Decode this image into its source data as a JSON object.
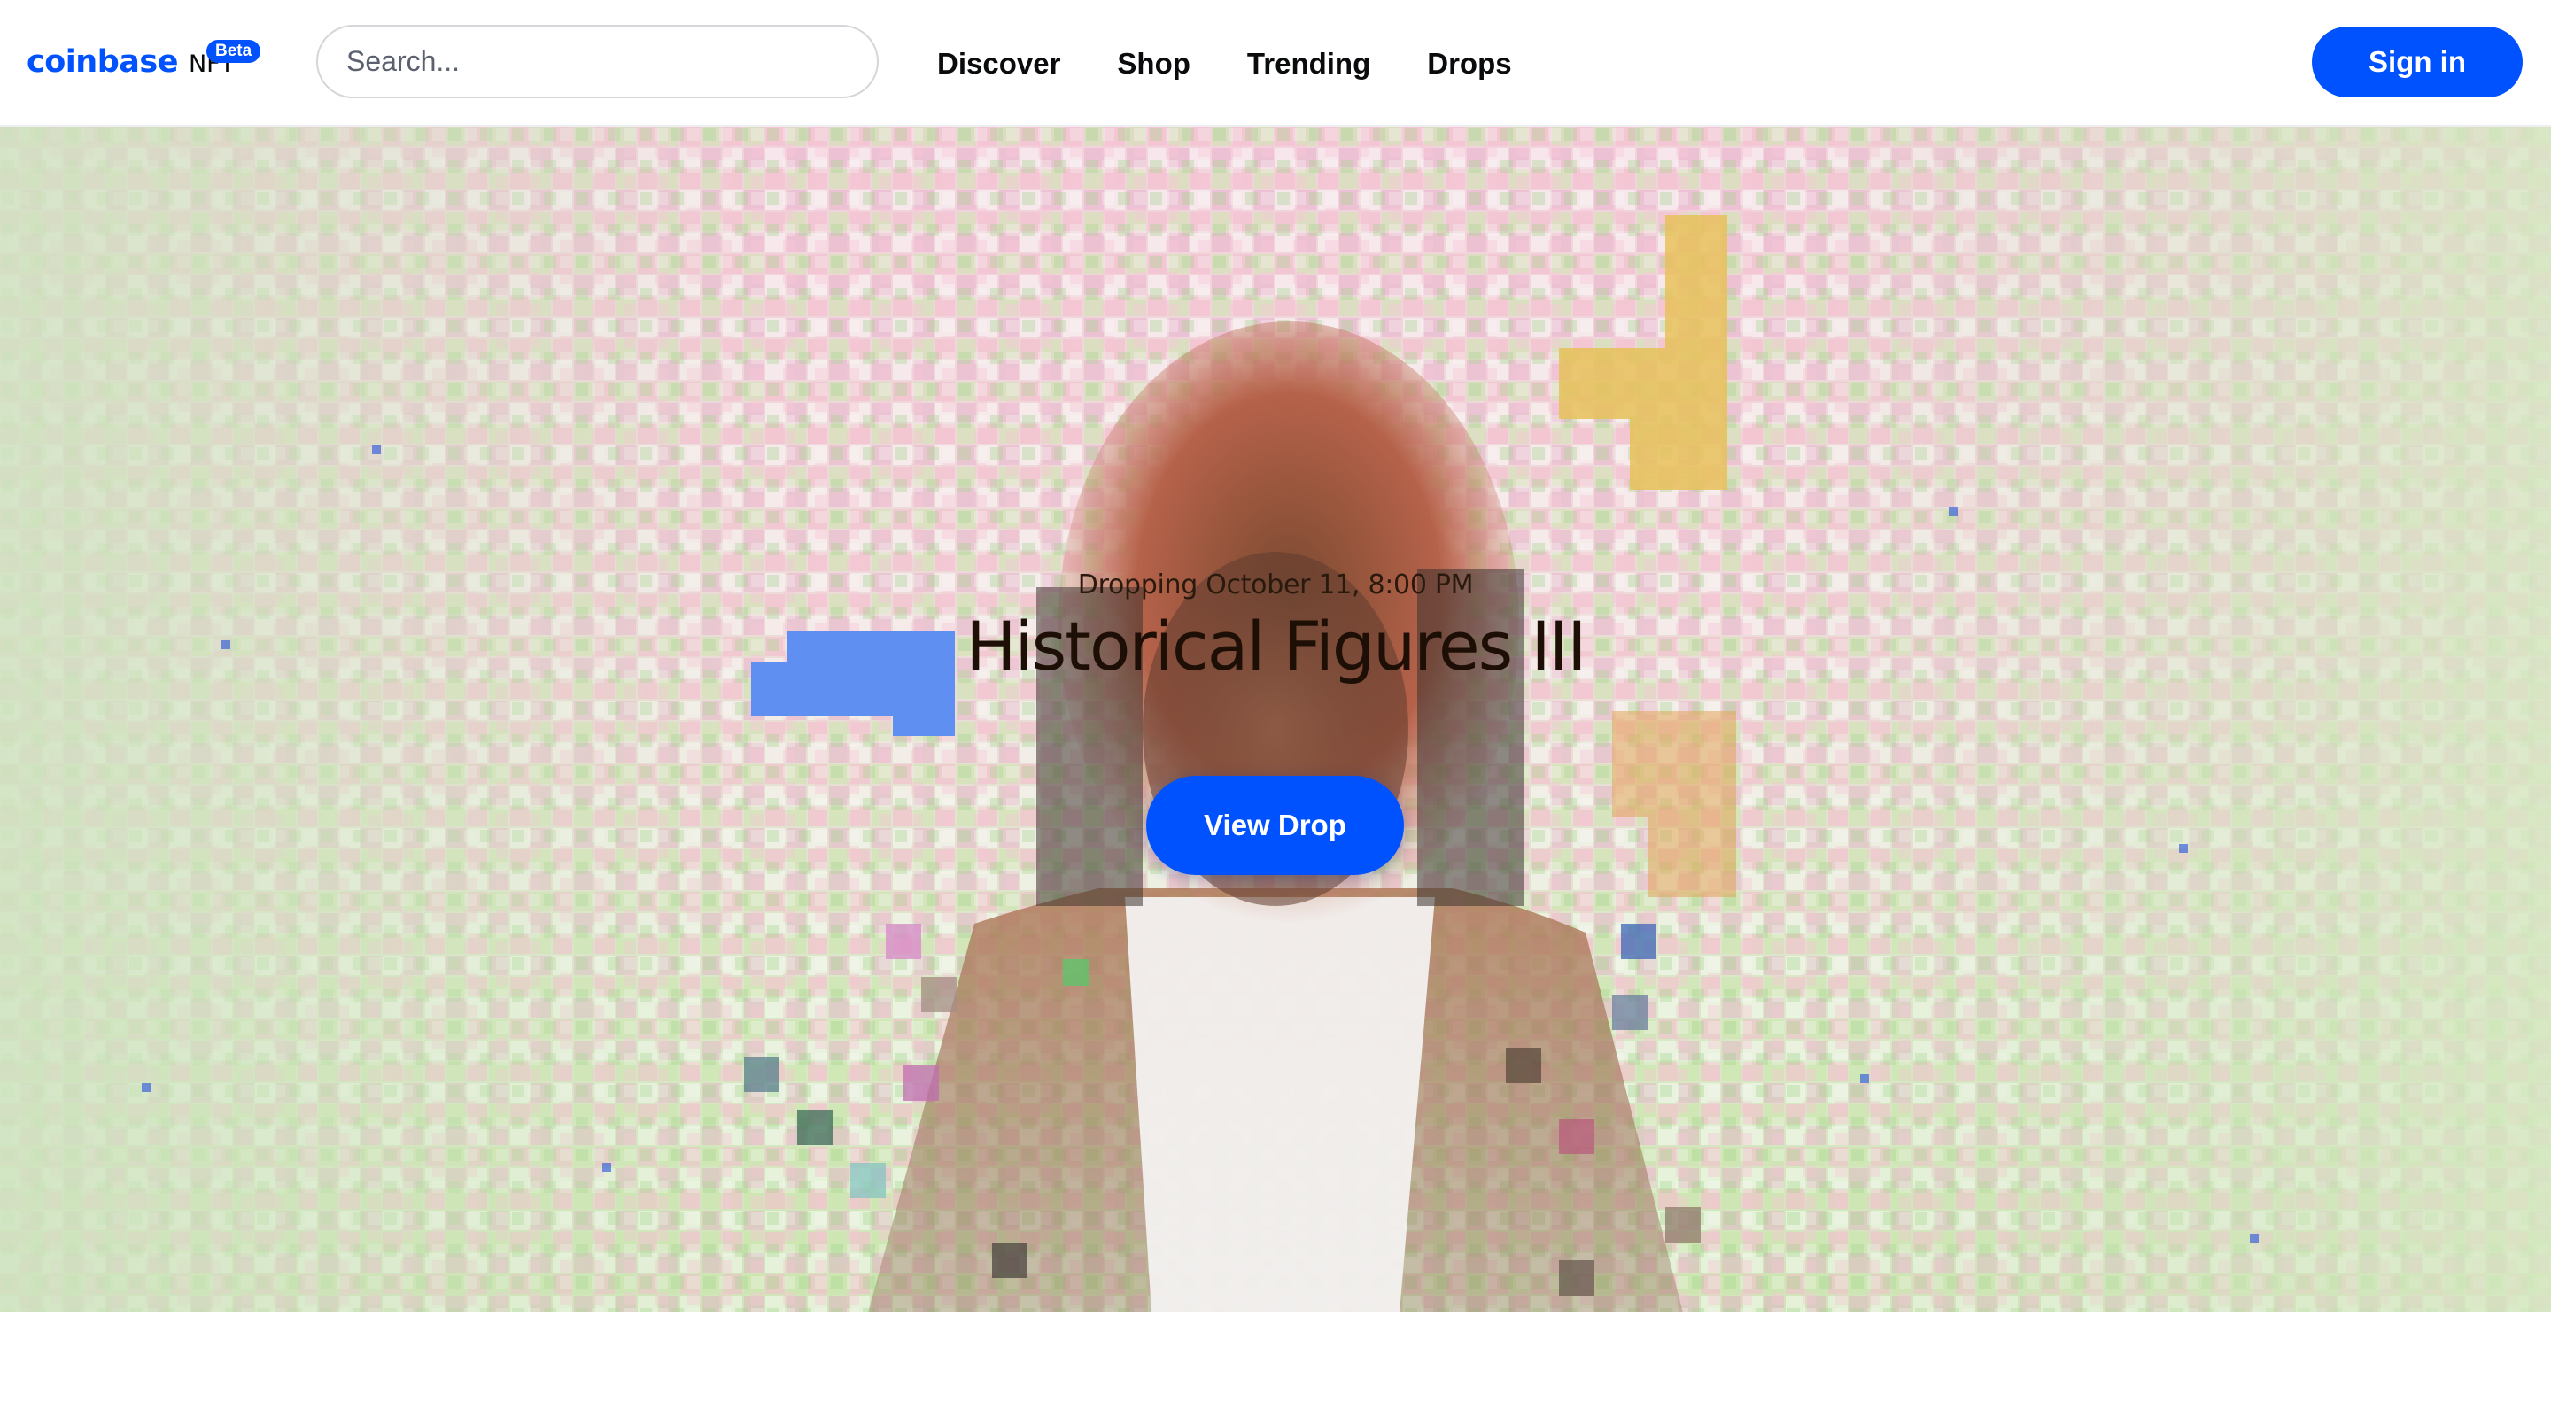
{
  "header": {
    "logo_word": "coinbase",
    "logo_suffix": "NFT",
    "badge": "Beta",
    "search_placeholder": "Search...",
    "nav": [
      "Discover",
      "Shop",
      "Trending",
      "Drops"
    ],
    "signin_label": "Sign in"
  },
  "hero": {
    "date": "Dropping October 11, 8:00 PM",
    "title": "Historical Figures III",
    "cta_label": "View Drop"
  },
  "colors": {
    "brand_blue": "#0052ff",
    "text_dark": "#0a0b0d"
  }
}
